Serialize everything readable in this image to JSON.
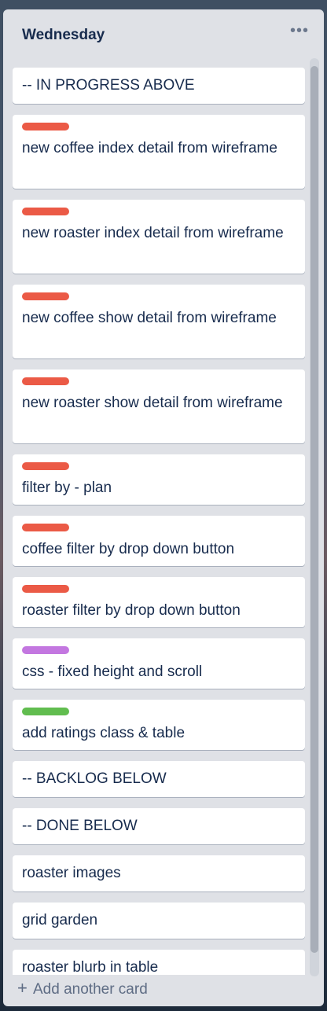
{
  "list": {
    "title": "Wednesday",
    "menu_icon": "more-horizontal-icon",
    "add_card_label": "Add another card",
    "add_icon": "plus-icon"
  },
  "label_colors": {
    "red": "#eb5a46",
    "purple": "#c377e0",
    "green": "#61bd4f"
  },
  "cards": [
    {
      "title": "-- IN PROGRESS ABOVE",
      "label": null
    },
    {
      "title": "new coffee index detail from wireframe",
      "label": "red"
    },
    {
      "title": "new roaster index detail from wireframe",
      "label": "red"
    },
    {
      "title": "new coffee show detail from wireframe",
      "label": "red"
    },
    {
      "title": "new roaster show detail from wireframe",
      "label": "red"
    },
    {
      "title": "filter by - plan",
      "label": "red"
    },
    {
      "title": "coffee filter by drop down button",
      "label": "red"
    },
    {
      "title": "roaster filter by drop down button",
      "label": "red"
    },
    {
      "title": "css - fixed height and scroll",
      "label": "purple"
    },
    {
      "title": "add ratings class & table",
      "label": "green"
    },
    {
      "title": "-- BACKLOG BELOW",
      "label": null
    },
    {
      "title": "-- DONE BELOW",
      "label": null
    },
    {
      "title": "roaster images",
      "label": null
    },
    {
      "title": "grid garden",
      "label": null
    },
    {
      "title": "roaster blurb in table",
      "label": null
    }
  ]
}
